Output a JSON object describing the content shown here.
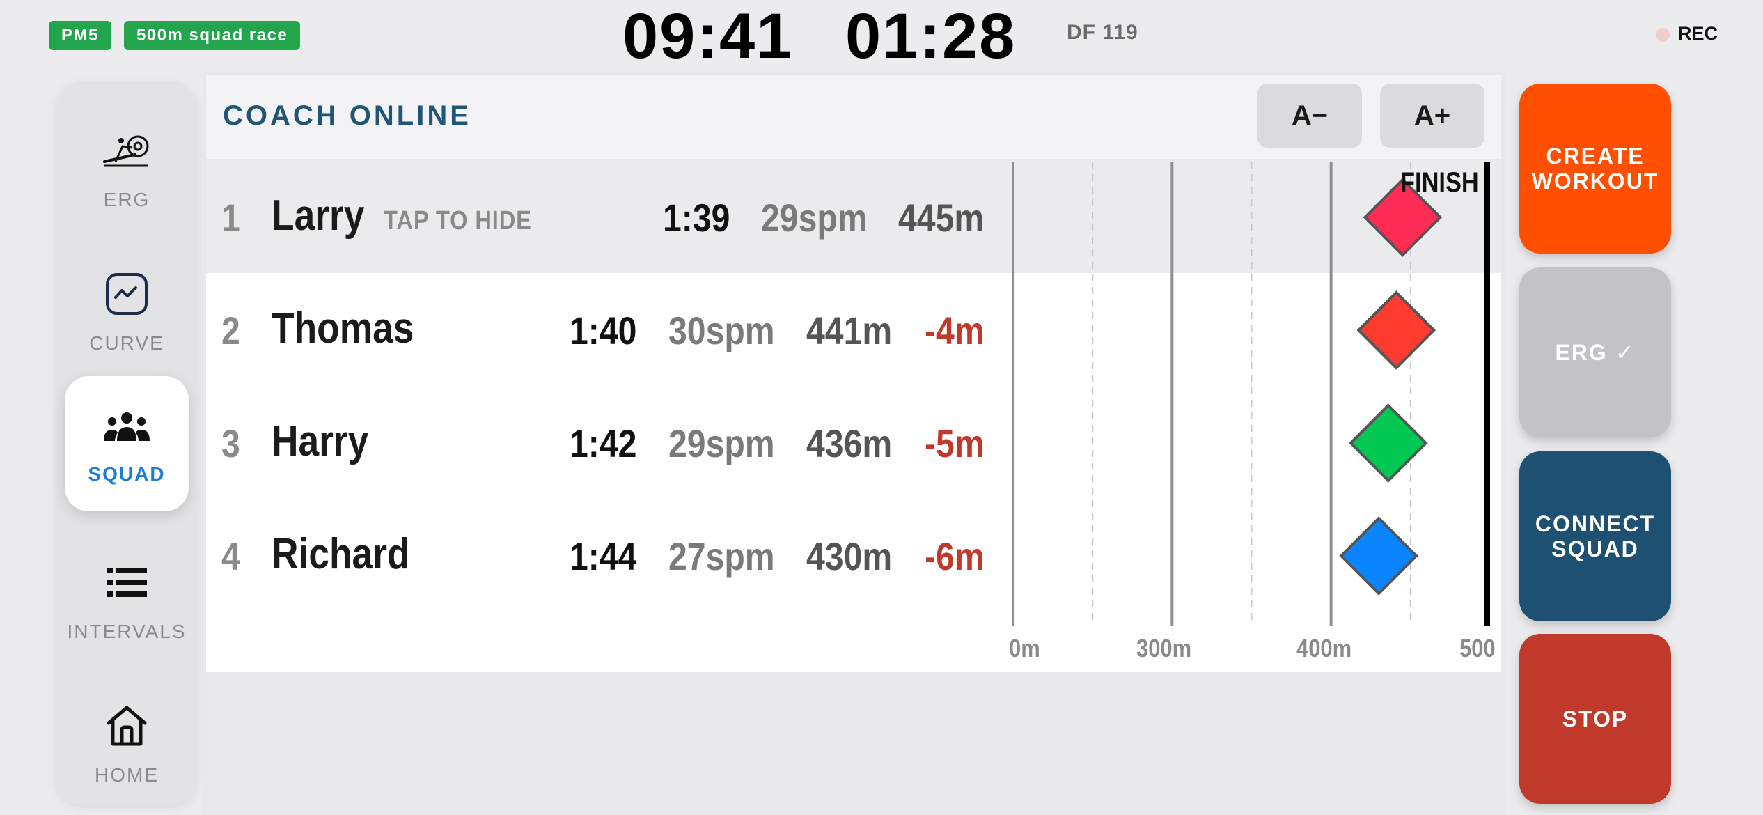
{
  "status": {
    "monitor_badge": "PM5",
    "workout_badge": "500m squad race",
    "clock_time": "09:41",
    "elapsed_time": "01:28",
    "drag_factor": "DF 119",
    "rec_label": "REC",
    "badge_color": "#23a54e",
    "rec_dot_color": "#f0cfcb"
  },
  "nav": {
    "items": [
      {
        "label": "ERG",
        "icon": "rowing-machine-icon"
      },
      {
        "label": "CURVE",
        "icon": "force-curve-icon"
      },
      {
        "label": "SQUAD",
        "icon": "group-icon",
        "active": true
      },
      {
        "label": "INTERVALS",
        "icon": "list-icon"
      },
      {
        "label": "HOME",
        "icon": "home-icon"
      }
    ],
    "active_color": "#1a7ed8"
  },
  "header": {
    "title": "COACH ONLINE",
    "font_decrease_label": "A−",
    "font_increase_label": "A+",
    "title_color": "#1f5677"
  },
  "squad": {
    "rows": [
      {
        "rank": "1",
        "name": "Larry",
        "hint": "TAP TO HIDE",
        "pace": "1:39",
        "spm": "29spm",
        "distance": "445m",
        "gap": "",
        "meters": 445,
        "color": "#ff2d55"
      },
      {
        "rank": "2",
        "name": "Thomas",
        "hint": "",
        "pace": "1:40",
        "spm": "30spm",
        "distance": "441m",
        "gap": "-4m",
        "meters": 441,
        "color": "#ff3b30"
      },
      {
        "rank": "3",
        "name": "Harry",
        "hint": "",
        "pace": "1:42",
        "spm": "29spm",
        "distance": "436m",
        "gap": "-5m",
        "meters": 436,
        "color": "#00c853"
      },
      {
        "rank": "4",
        "name": "Richard",
        "hint": "",
        "pace": "1:44",
        "spm": "27spm",
        "distance": "430m",
        "gap": "-6m",
        "meters": 430,
        "color": "#0a84ff"
      }
    ],
    "track": {
      "axis_labels": [
        "0m",
        "300m",
        "400m",
        "500"
      ],
      "finish_label": "FINISH",
      "view_min_m": 200,
      "view_max_m": 500,
      "major_ticks_m": [
        200,
        300,
        400
      ],
      "minor_ticks_m": [
        250,
        350,
        450
      ],
      "finish_m": 500
    }
  },
  "actions": [
    {
      "label": "CREATE WORKOUT",
      "color": "#ff4f00"
    },
    {
      "label": "ERG ✓",
      "color": "#c3c3c5"
    },
    {
      "label": "CONNECT SQUAD",
      "color": "#1d5071"
    },
    {
      "label": "STOP",
      "color": "#c0392b"
    }
  ]
}
